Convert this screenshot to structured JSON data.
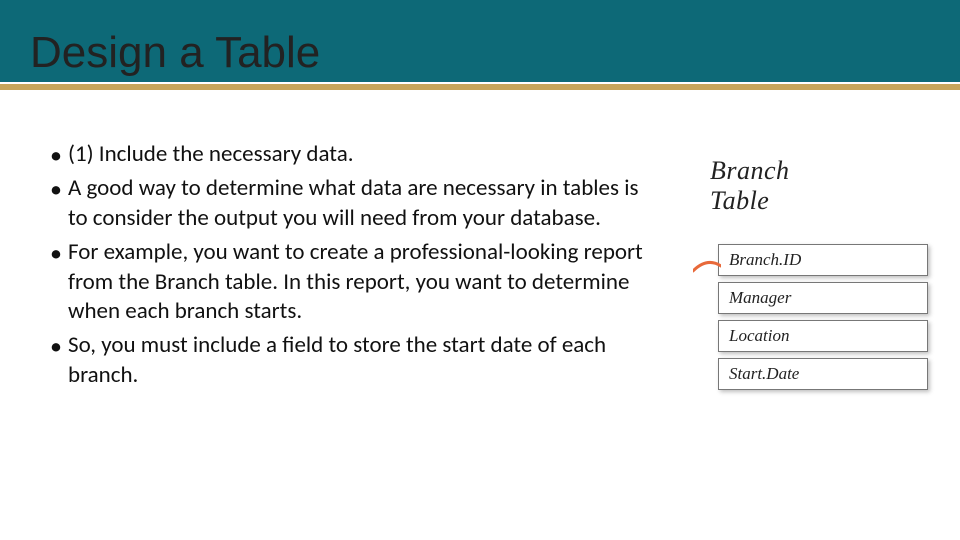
{
  "slide": {
    "title": "Design a Table",
    "bullets": [
      "(1) Include the necessary data.",
      "A good way to determine what data are necessary in tables is to consider the output you will need from your database.",
      "For example, you want to create a professional-looking report from the Branch table. In this report, you want to determine when each branch starts.",
      "So, you must include a field to store the start date of each branch."
    ]
  },
  "figure": {
    "caption_line1": "Branch",
    "caption_line2": "Table",
    "rows": [
      {
        "label": "Branch.ID",
        "highlighted": true
      },
      {
        "label": "Manager",
        "highlighted": false
      },
      {
        "label": "Location",
        "highlighted": false
      },
      {
        "label": "Start.Date",
        "highlighted": false
      }
    ]
  },
  "colors": {
    "title_bar": "#0d6977",
    "underline": "#c7a55a",
    "highlight_connector": "#e8693a"
  }
}
